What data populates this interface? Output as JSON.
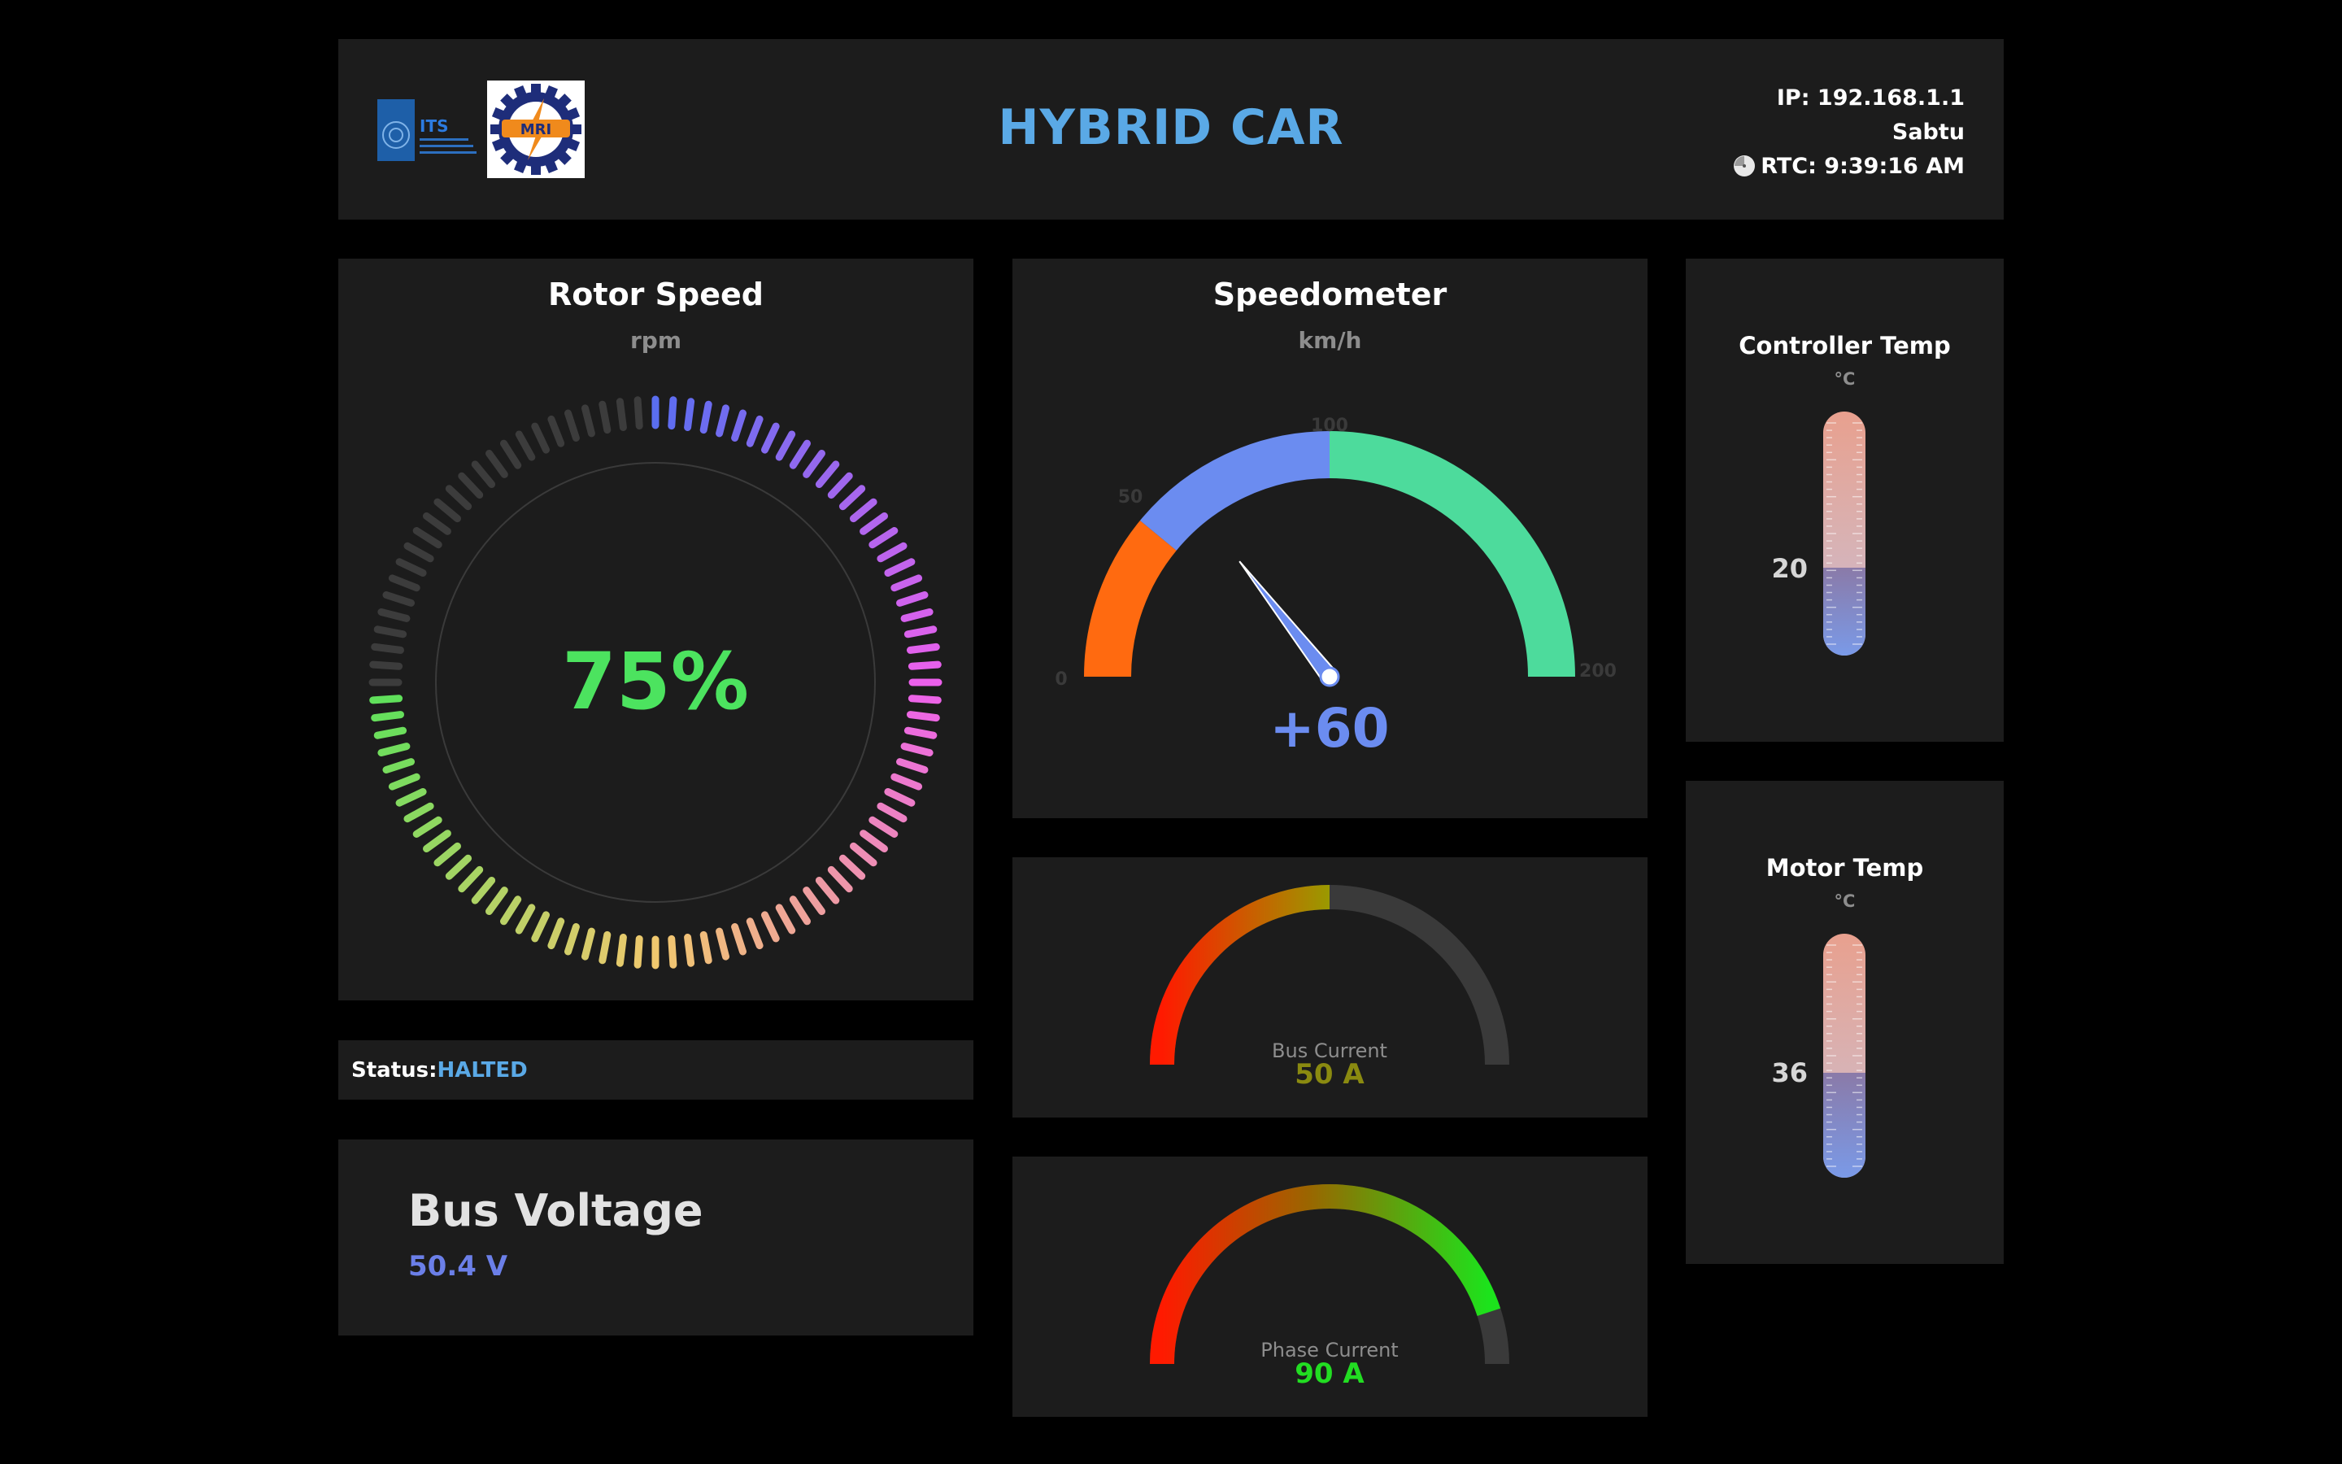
{
  "header": {
    "title": "HYBRID CAR",
    "ip": "IP: 192.168.1.1",
    "day": "Sabtu",
    "rtc": "RTC: 9:39:16 AM",
    "logos": {
      "its_text": "ITS",
      "mri_text": "MRI"
    }
  },
  "rotor": {
    "title": "Rotor Speed",
    "unit": "rpm",
    "display": "75%",
    "fraction": 0.75
  },
  "status": {
    "label": "Status:",
    "value": "HALTED"
  },
  "bus_voltage": {
    "title": "Bus Voltage",
    "value": "50.4 V"
  },
  "speedometer": {
    "title": "Speedometer",
    "unit": "km/h",
    "display": "+60",
    "value": 60,
    "min": 0,
    "max": 200,
    "ticks": [
      "0",
      "50",
      "100",
      "200"
    ]
  },
  "bus_current": {
    "label": "Bus Current",
    "display": "50 A",
    "value": 50,
    "max": 100,
    "value_color": "#8a8a10"
  },
  "phase_current": {
    "label": "Phase Current",
    "display": "90 A",
    "value": 90,
    "max": 100,
    "value_color": "#22dd22"
  },
  "controller_temp": {
    "title": "Controller Temp",
    "unit": "°C",
    "display": "20",
    "level": 0.36
  },
  "motor_temp": {
    "title": "Motor Temp",
    "unit": "°C",
    "display": "36",
    "level": 0.43
  },
  "colors": {
    "accent_blue": "#5aa9e6",
    "card_bg": "#1c1c1c",
    "speedo_orange": "#ff6a10",
    "speedo_blue": "#6b8cf0",
    "speedo_green": "#4ddb9c"
  }
}
